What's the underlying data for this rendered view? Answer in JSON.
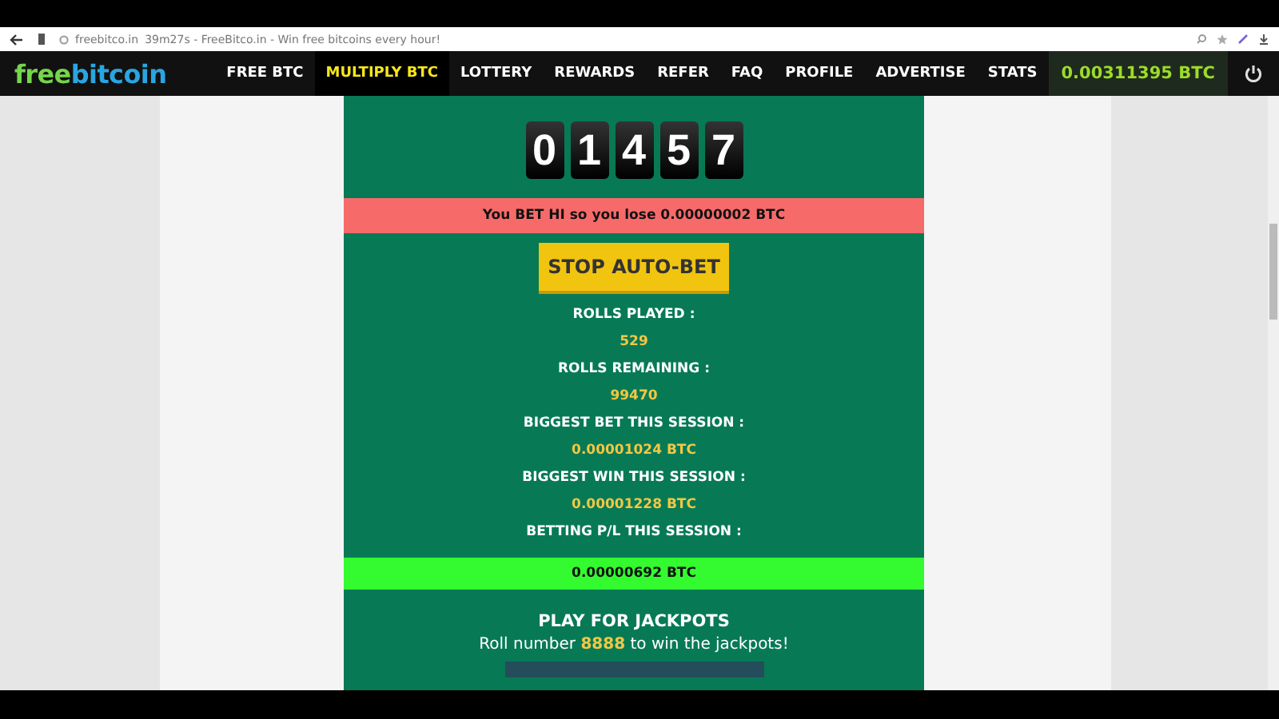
{
  "browser": {
    "url": "freebitco.in",
    "title": "39m27s - FreeBitco.in - Win free bitcoins every hour!"
  },
  "logo": {
    "part_1": "free",
    "part_2": "bitcoin"
  },
  "nav": [
    {
      "label": "FREE BTC",
      "selected": false
    },
    {
      "label": "MULTIPLY BTC",
      "selected": true
    },
    {
      "label": "LOTTERY",
      "selected": false
    },
    {
      "label": "REWARDS",
      "selected": false
    },
    {
      "label": "REFER",
      "selected": false
    },
    {
      "label": "FAQ",
      "selected": false
    },
    {
      "label": "PROFILE",
      "selected": false
    },
    {
      "label": "ADVERTISE",
      "selected": false
    },
    {
      "label": "STATS",
      "selected": false
    }
  ],
  "balance": "0.00311395 BTC",
  "roll_digits": [
    "0",
    "1",
    "4",
    "5",
    "7"
  ],
  "result_message": "You BET HI so you lose 0.00000002 BTC",
  "stop_button": "STOP AUTO-BET",
  "stats": [
    {
      "label": "ROLLS PLAYED :",
      "value": "529"
    },
    {
      "label": "ROLLS REMAINING :",
      "value": "99470"
    },
    {
      "label": "BIGGEST BET THIS SESSION :",
      "value": "0.00001024 BTC"
    },
    {
      "label": "BIGGEST WIN THIS SESSION :",
      "value": "0.00001228 BTC"
    }
  ],
  "profit": {
    "label": "BETTING P/L THIS SESSION :",
    "value": "0.00000692 BTC"
  },
  "jackpot": {
    "title": "PLAY FOR JACKPOTS",
    "text_before": "Roll number",
    "number": "8888",
    "text_after": "to win the jackpots!"
  }
}
